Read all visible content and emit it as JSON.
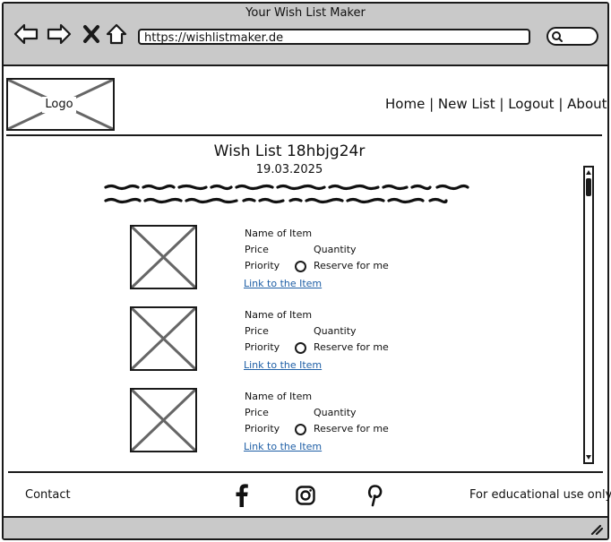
{
  "window": {
    "title": "Your Wish List Maker",
    "url": "https://wishlistmaker.de"
  },
  "header": {
    "logo_label": "Logo",
    "nav": [
      "Home",
      "New List",
      "Logout",
      "About"
    ],
    "separator": " | "
  },
  "main": {
    "title": "Wish List 18hbjg24r",
    "date": "19.03.2025",
    "items": [
      {
        "name": "Name of Item",
        "price": "Price",
        "quantity": "Quantity",
        "priority": "Priority",
        "reserve": "Reserve for me",
        "link": "Link to the Item"
      },
      {
        "name": "Name of Item",
        "price": "Price",
        "quantity": "Quantity",
        "priority": "Priority",
        "reserve": "Reserve for me",
        "link": "Link to the Item"
      },
      {
        "name": "Name of Item",
        "price": "Price",
        "quantity": "Quantity",
        "priority": "Priority",
        "reserve": "Reserve for me",
        "link": "Link to the Item"
      }
    ]
  },
  "footer": {
    "contact": "Contact",
    "note": "For educational use only",
    "social_icons": [
      "facebook-icon",
      "instagram-icon",
      "pinterest-icon"
    ]
  },
  "colors": {
    "chrome": "#c9c9c9",
    "link": "#1f5fa6",
    "placeholder_cross": "#666666"
  }
}
